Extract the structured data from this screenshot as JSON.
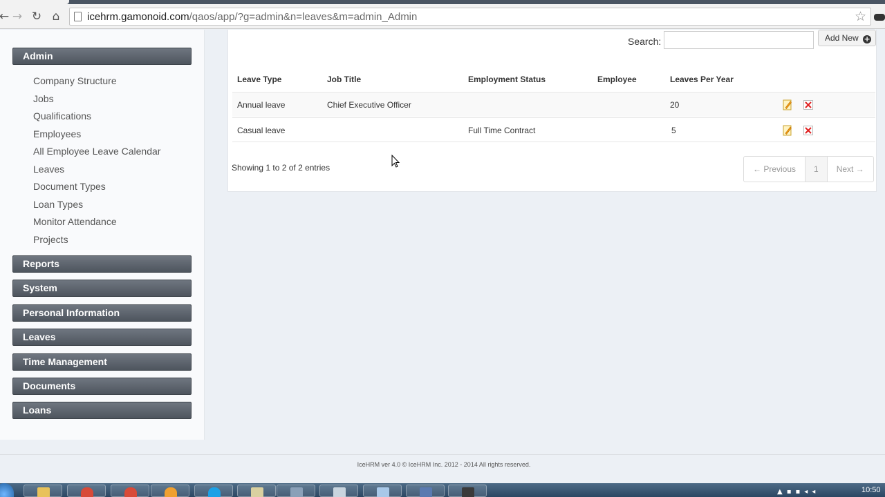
{
  "browser": {
    "url_domain": "icehrm.gamonoid.com",
    "url_path": "/qaos/app/?g=admin&n=leaves&m=admin_Admin",
    "back_icon": "←",
    "forward_icon": "→",
    "reload_icon": "↻",
    "home_icon": "⌂",
    "star_icon": "☆"
  },
  "sidebar": {
    "admin_header": "Admin",
    "admin_items": [
      "Company Structure",
      "Jobs",
      "Qualifications",
      "Employees",
      "All Employee Leave Calendar",
      "Leaves",
      "Document Types",
      "Loan Types",
      "Monitor Attendance",
      "Projects"
    ],
    "sections": [
      "Reports",
      "System",
      "Personal Information",
      "Leaves",
      "Time Management",
      "Documents",
      "Loans"
    ]
  },
  "main": {
    "search_label": "Search:",
    "search_value": "",
    "add_new_label": "Add New",
    "columns": [
      "Leave Type",
      "Job Title",
      "Employment Status",
      "Employee",
      "Leaves Per Year"
    ],
    "rows": [
      [
        "Annual leave",
        "Chief Executive Officer",
        "",
        "",
        "20"
      ],
      [
        "Casual leave",
        "",
        "Full Time Contract",
        "",
        "5"
      ]
    ],
    "info_text": "Showing 1 to 2 of 2 entries",
    "pagination": {
      "previous": "← Previous",
      "current": "1",
      "next": "Next →"
    }
  },
  "footer": {
    "text": "IceHRM ver 4.0 © IceHRM Inc. 2012 - 2014 All rights reserved."
  },
  "taskbar": {
    "clock": "10:50",
    "accent": "#2c4763"
  }
}
